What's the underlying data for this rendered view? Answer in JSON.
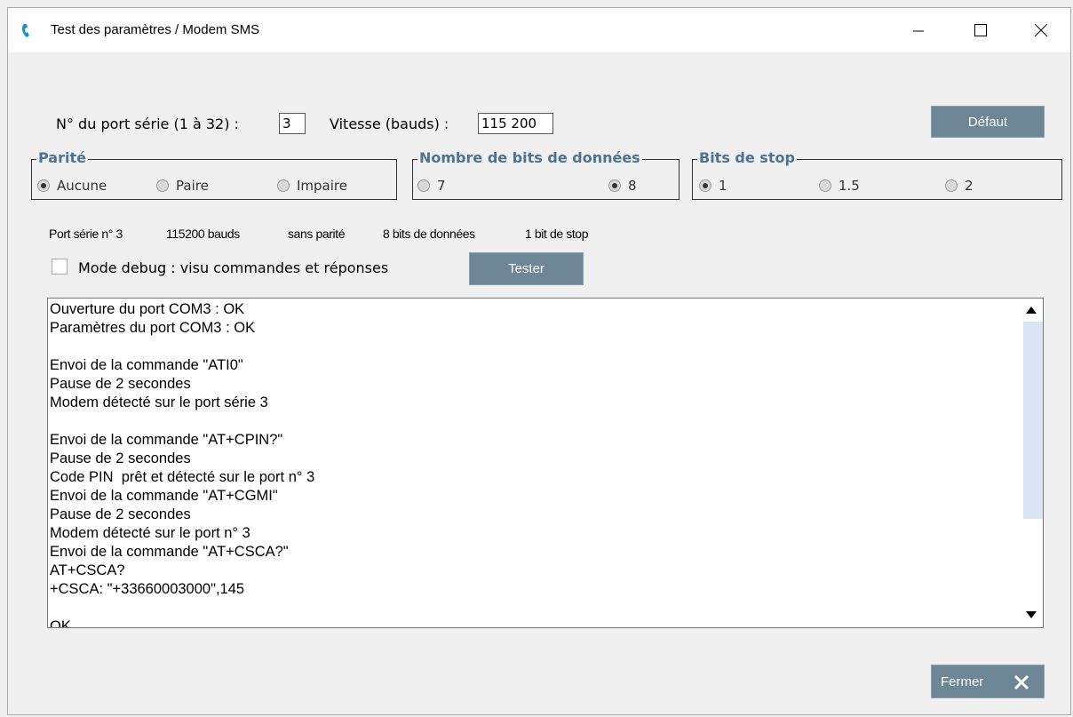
{
  "window": {
    "title": "Test des paramètres / Modem SMS"
  },
  "port": {
    "label": "N° du port série (1 à 32) :",
    "value": "3"
  },
  "speed": {
    "label": "Vitesse (bauds) :",
    "value": "115 200"
  },
  "buttons": {
    "default": "Défaut",
    "test": "Tester",
    "close": "Fermer"
  },
  "parity": {
    "legend": "Parité",
    "options": [
      "Aucune",
      "Paire",
      "Impaire"
    ],
    "selected": "Aucune"
  },
  "databits": {
    "legend": "Nombre de bits de données",
    "options": [
      "7",
      "8"
    ],
    "selected": "8"
  },
  "stopbits": {
    "legend": "Bits de stop",
    "options": [
      "1",
      "1.5",
      "2"
    ],
    "selected": "1"
  },
  "summary": {
    "port": "Port série n° 3",
    "bauds": "115200 bauds",
    "parity": "sans parité",
    "databits": "8 bits de données",
    "stopbits": "1 bit de stop"
  },
  "debug": {
    "label": "Mode debug : visu commandes et réponses",
    "checked": false
  },
  "log": {
    "lines": [
      "Ouverture du port COM3 : OK",
      "Paramètres du port COM3 : OK",
      "",
      "Envoi de la commande \"ATI0\"",
      "Pause de 2 secondes",
      "Modem détecté sur le port série 3",
      "",
      "Envoi de la commande \"AT+CPIN?\"",
      "Pause de 2 secondes",
      "Code PIN  prêt et détecté sur le port n° 3",
      "Envoi de la commande \"AT+CGMI\"",
      "Pause de 2 secondes",
      "Modem détecté sur le port n° 3",
      "Envoi de la commande \"AT+CSCA?\"",
      "AT+CSCA?",
      "+CSCA: \"+33660003000\",145",
      "",
      "OK"
    ]
  },
  "colors": {
    "accent": "#6e8797",
    "legend": "#4d7392",
    "scroll_thumb": "#dbe6f4"
  }
}
